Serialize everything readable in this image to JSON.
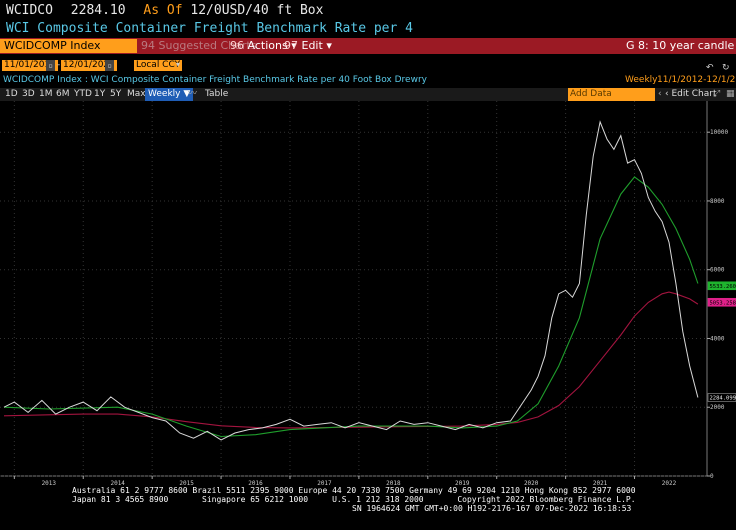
{
  "header": {
    "ticker": "WCIDCO",
    "price": "2284.10",
    "as_of": "As Of",
    "date_short": "12/0",
    "unit": "USD/40 ft Box",
    "title": "WCI Composite Container Freight Benchmark Rate per 4"
  },
  "command_bar": {
    "ticker_field": "WCIDCOMP Index",
    "suggested": "Suggested Charts",
    "suggested_num": "94",
    "actions": "Actions",
    "actions_num": "96",
    "edit": "Edit",
    "edit_num": "97",
    "template": "G 8: 10 year candle ema"
  },
  "controls": {
    "start_date": "11/01/2012",
    "end_date": "12/01/2022",
    "currency": "Local CCY",
    "description": "WCIDCOMP Index : WCI Composite Container Freight Benchmark Rate per 40 Foot Box Drewry",
    "frequency_label": "Weekly",
    "range_label": "11/1/2012-12/1/2022"
  },
  "toolbar": {
    "periods": [
      "1D",
      "3D",
      "1M",
      "6M",
      "YTD",
      "1Y",
      "5Y",
      "Max"
    ],
    "weekly": "Weekly",
    "table": "Table",
    "add_data": "Add Data",
    "edit_chart": "Edit Chart"
  },
  "colors": {
    "price_line": "#d9d9d9",
    "ema_green": "#1f9e2c",
    "ema_red": "#a3143f",
    "green_tag": "#1fb32e",
    "magenta_tag": "#e0218a",
    "accent_orange": "#ff9e1b",
    "bar_red": "#9b1a24"
  },
  "chart_data": {
    "type": "line",
    "title": "",
    "xlabel": "",
    "ylabel": "",
    "ylim": [
      0,
      10500
    ],
    "xlim": [
      2012.85,
      2022.95
    ],
    "yticks": [
      0,
      2000,
      4000,
      6000,
      8000,
      10000
    ],
    "xticks": [
      2013,
      2014,
      2015,
      2016,
      2017,
      2018,
      2019,
      2020,
      2021,
      2022
    ],
    "series": [
      {
        "name": "",
        "color": "#d9d9d9",
        "x": [
          2012.85,
          2013.0,
          2013.2,
          2013.4,
          2013.6,
          2013.8,
          2014.0,
          2014.2,
          2014.4,
          2014.6,
          2014.8,
          2015.0,
          2015.2,
          2015.4,
          2015.6,
          2015.8,
          2016.0,
          2016.2,
          2016.4,
          2016.6,
          2016.8,
          2017.0,
          2017.2,
          2017.4,
          2017.6,
          2017.8,
          2018.0,
          2018.2,
          2018.4,
          2018.6,
          2018.8,
          2019.0,
          2019.2,
          2019.4,
          2019.6,
          2019.8,
          2020.0,
          2020.2,
          2020.4,
          2020.5,
          2020.6,
          2020.7,
          2020.8,
          2020.9,
          2021.0,
          2021.1,
          2021.2,
          2021.3,
          2021.4,
          2021.5,
          2021.6,
          2021.7,
          2021.8,
          2021.9,
          2022.0,
          2022.1,
          2022.2,
          2022.3,
          2022.4,
          2022.5,
          2022.6,
          2022.7,
          2022.8,
          2022.92
        ],
        "values": [
          2000,
          2150,
          1850,
          2200,
          1800,
          2000,
          2150,
          1900,
          2300,
          2000,
          1850,
          1700,
          1600,
          1250,
          1100,
          1300,
          1050,
          1250,
          1350,
          1400,
          1500,
          1650,
          1450,
          1500,
          1550,
          1400,
          1550,
          1450,
          1350,
          1600,
          1500,
          1550,
          1450,
          1350,
          1500,
          1400,
          1550,
          1600,
          2200,
          2500,
          2900,
          3500,
          4600,
          5300,
          5400,
          5200,
          5600,
          7600,
          9300,
          10300,
          9800,
          9500,
          9900,
          9100,
          9200,
          8800,
          8100,
          7700,
          7400,
          6800,
          5600,
          4200,
          3200,
          2284
        ]
      },
      {
        "name": "",
        "color": "#1f9e2c",
        "x": [
          2012.85,
          2013.5,
          2014.5,
          2015.0,
          2015.5,
          2016.0,
          2016.5,
          2017.0,
          2018.0,
          2019.0,
          2019.5,
          2020.0,
          2020.3,
          2020.6,
          2020.9,
          2021.2,
          2021.5,
          2021.8,
          2022.0,
          2022.2,
          2022.4,
          2022.6,
          2022.8,
          2022.92
        ],
        "values": [
          2000,
          1950,
          2000,
          1800,
          1450,
          1150,
          1200,
          1350,
          1450,
          1450,
          1400,
          1450,
          1600,
          2100,
          3200,
          4600,
          6900,
          8200,
          8700,
          8400,
          7900,
          7200,
          6300,
          5600
        ]
      },
      {
        "name": "",
        "color": "#a3143f",
        "x": [
          2012.85,
          2013.5,
          2014.0,
          2014.5,
          2015.0,
          2015.5,
          2016.0,
          2016.5,
          2017.0,
          2018.0,
          2019.0,
          2019.5,
          2020.0,
          2020.3,
          2020.6,
          2020.9,
          2021.2,
          2021.5,
          2021.8,
          2022.0,
          2022.2,
          2022.4,
          2022.5,
          2022.6,
          2022.8,
          2022.92
        ],
        "values": [
          1750,
          1780,
          1800,
          1800,
          1720,
          1580,
          1460,
          1410,
          1400,
          1420,
          1440,
          1450,
          1500,
          1560,
          1720,
          2050,
          2600,
          3350,
          4100,
          4650,
          5050,
          5300,
          5350,
          5300,
          5150,
          5000
        ]
      }
    ],
    "value_tags": [
      {
        "label": "5533.2608",
        "value": 5533,
        "color": "#1fb32e"
      },
      {
        "label": "5053.2580",
        "value": 5053,
        "color": "#e0218a"
      },
      {
        "label": "2284.0997",
        "value": 2284,
        "color": "#000000"
      }
    ]
  },
  "footer": {
    "line1": "Australia 61 2 9777 8600 Brazil 5511 2395 9000 Europe 44 20 7330 7500 Germany 49 69 9204 1210 Hong Kong 852 2977 6000",
    "line2": "Japan 81 3 4565 8900       Singapore 65 6212 1000     U.S. 1 212 318 2000       Copyright 2022 Bloomberg Finance L.P.",
    "line3": "SN 1964624 GMT GMT+0:00 H192-2176-167 07-Dec-2022 16:18:53"
  }
}
